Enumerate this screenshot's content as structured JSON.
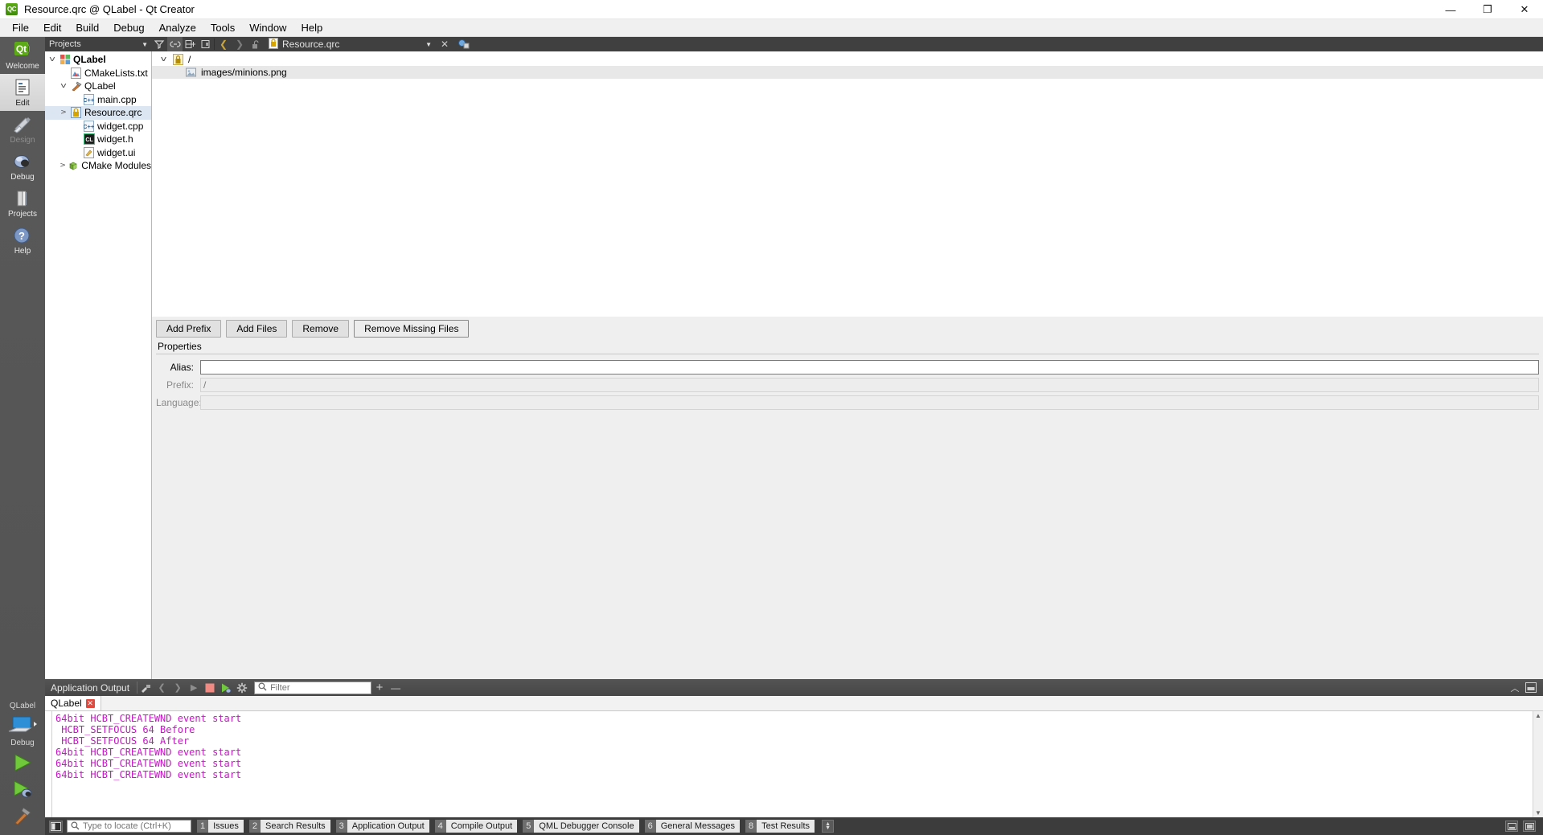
{
  "window": {
    "title": "Resource.qrc @ QLabel - Qt Creator",
    "app_icon_text": "QC",
    "minimize": "—",
    "maximize": "❐",
    "close": "✕"
  },
  "menubar": {
    "items": [
      "File",
      "Edit",
      "Build",
      "Debug",
      "Analyze",
      "Tools",
      "Window",
      "Help"
    ]
  },
  "modebar": {
    "modes": [
      {
        "label": "Welcome",
        "icon": "qt-logo-icon",
        "state": "normal"
      },
      {
        "label": "Edit",
        "icon": "edit-document-icon",
        "state": "active"
      },
      {
        "label": "Design",
        "icon": "design-tools-icon",
        "state": "disabled"
      },
      {
        "label": "Debug",
        "icon": "bug-icon",
        "state": "normal"
      },
      {
        "label": "Projects",
        "icon": "projects-folder-icon",
        "state": "normal"
      },
      {
        "label": "Help",
        "icon": "help-question-icon",
        "state": "normal"
      }
    ],
    "kit_name": "QLabel",
    "run_config": "Debug",
    "actions": [
      {
        "name": "run-button",
        "icon": "green-play-icon"
      },
      {
        "name": "debug-button",
        "icon": "play-bug-icon"
      },
      {
        "name": "build-button",
        "icon": "hammer-icon"
      }
    ]
  },
  "toolbar": {
    "project_selector": "Projects",
    "project_selector_caret": "▼",
    "buttons": [
      {
        "name": "filter-tree-button",
        "icon": "filter-icon"
      },
      {
        "name": "synchronize-selection-button",
        "icon": "link-icon",
        "pressed": true
      },
      {
        "name": "split-add-button",
        "icon": "split-icon"
      },
      {
        "name": "close-split-button",
        "icon": "close-split-icon"
      }
    ],
    "nav_back": "❮",
    "nav_forward": "❯",
    "lock_icon": "unlocked-padlock-icon",
    "open_file": "Resource.qrc",
    "file_caret": "▼",
    "close_file": "✕",
    "extra_icon": "magnifier-copy-icon"
  },
  "project_tree": {
    "nodes": [
      {
        "depth": 0,
        "twisty": "v",
        "icon": "project-icon",
        "label": "QLabel",
        "bold": true,
        "selected": false
      },
      {
        "depth": 1,
        "twisty": "",
        "icon": "cmake-file-icon",
        "label": "CMakeLists.txt",
        "bold": false,
        "selected": false
      },
      {
        "depth": 1,
        "twisty": "v",
        "icon": "hammer-icon",
        "label": "QLabel",
        "bold": false,
        "selected": false
      },
      {
        "depth": 2,
        "twisty": "",
        "icon": "cpp-file-icon",
        "label": "main.cpp",
        "bold": false,
        "selected": false
      },
      {
        "depth": 2,
        "twisty": ">",
        "icon": "qrc-file-icon",
        "label": "Resource.qrc",
        "bold": false,
        "selected": true
      },
      {
        "depth": 2,
        "twisty": "",
        "icon": "cpp-file-icon",
        "label": "widget.cpp",
        "bold": false,
        "selected": false
      },
      {
        "depth": 2,
        "twisty": "",
        "icon": "header-file-icon",
        "label": "widget.h",
        "bold": false,
        "selected": false
      },
      {
        "depth": 2,
        "twisty": "",
        "icon": "ui-file-icon",
        "label": "widget.ui",
        "bold": false,
        "selected": false
      },
      {
        "depth": 1,
        "twisty": ">",
        "icon": "cmake-modules-icon",
        "label": "CMake Modules",
        "bold": false,
        "selected": false
      }
    ]
  },
  "qrc_editor": {
    "rows": [
      {
        "twisty": "v",
        "icon": "prefix-icon",
        "label": "/",
        "alt": false
      },
      {
        "twisty": "",
        "icon": "image-file-icon",
        "label": "images/minions.png",
        "alt": true
      }
    ],
    "buttons": [
      "Add Prefix",
      "Add Files",
      "Remove",
      "Remove Missing Files"
    ],
    "properties": {
      "title": "Properties",
      "fields": [
        {
          "label": "Alias:",
          "value": "",
          "enabled": true
        },
        {
          "label": "Prefix:",
          "value": "/",
          "enabled": false
        },
        {
          "label": "Language:",
          "value": "",
          "enabled": false
        }
      ]
    }
  },
  "output": {
    "title": "Application Output",
    "toolbar_icons": [
      {
        "name": "clean-output-icon",
        "glyph": "broom-icon"
      },
      {
        "name": "prev-item-icon",
        "glyph": "❮"
      },
      {
        "name": "next-item-icon",
        "glyph": "❯"
      },
      {
        "name": "run-output-icon",
        "glyph": "▶"
      },
      {
        "name": "stop-button-icon",
        "glyph": "stop-square-icon"
      },
      {
        "name": "rerun-debug-icon",
        "glyph": "play-bug-icon"
      },
      {
        "name": "settings-gear-icon",
        "glyph": "gear-icon"
      }
    ],
    "filter_placeholder": "Filter",
    "zoom_in": "+",
    "zoom_out": "—",
    "collapse": "︿",
    "maximize_pane": "⊟",
    "tabs": [
      {
        "label": "QLabel",
        "close": "✕"
      }
    ],
    "lines": [
      "64bit HCBT_CREATEWND event start",
      " HCBT_SETFOCUS 64 Before",
      " HCBT_SETFOCUS 64 After",
      "64bit HCBT_CREATEWND event start",
      "64bit HCBT_CREATEWND event start",
      "64bit HCBT_CREATEWND event start"
    ],
    "text_color": "#c417c4",
    "scroll_up": "▲",
    "scroll_down": "▼"
  },
  "statusbar": {
    "sidebar_toggle_icon": "sidebar-toggle-icon",
    "locator_placeholder": "Type to locate (Ctrl+K)",
    "locator_icon": "search-icon",
    "panes": [
      {
        "num": "1",
        "label": "Issues"
      },
      {
        "num": "2",
        "label": "Search Results"
      },
      {
        "num": "3",
        "label": "Application Output"
      },
      {
        "num": "4",
        "label": "Compile Output"
      },
      {
        "num": "5",
        "label": "QML Debugger Console"
      },
      {
        "num": "6",
        "label": "General Messages"
      },
      {
        "num": "8",
        "label": "Test Results"
      }
    ],
    "stepper_up": "▲",
    "stepper_down": "▼"
  }
}
